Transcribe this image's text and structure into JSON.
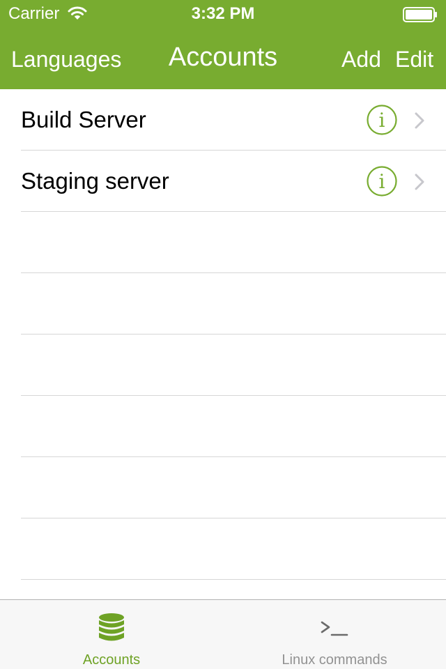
{
  "status_bar": {
    "carrier": "Carrier",
    "time": "3:32 PM"
  },
  "nav_bar": {
    "back_label": "Languages",
    "title": "Accounts",
    "add_label": "Add",
    "edit_label": "Edit"
  },
  "accounts": [
    {
      "name": "Build Server"
    },
    {
      "name": "Staging server"
    }
  ],
  "tab_bar": {
    "tabs": [
      {
        "label": "Accounts",
        "icon": "database-icon",
        "selected": true
      },
      {
        "label": "Linux commands",
        "icon": "terminal-icon",
        "selected": false
      }
    ]
  },
  "colors": {
    "accent": "#78ac30",
    "tab_selected": "#6ea225",
    "tab_unselected": "#929292",
    "separator": "#d6d6d6"
  }
}
